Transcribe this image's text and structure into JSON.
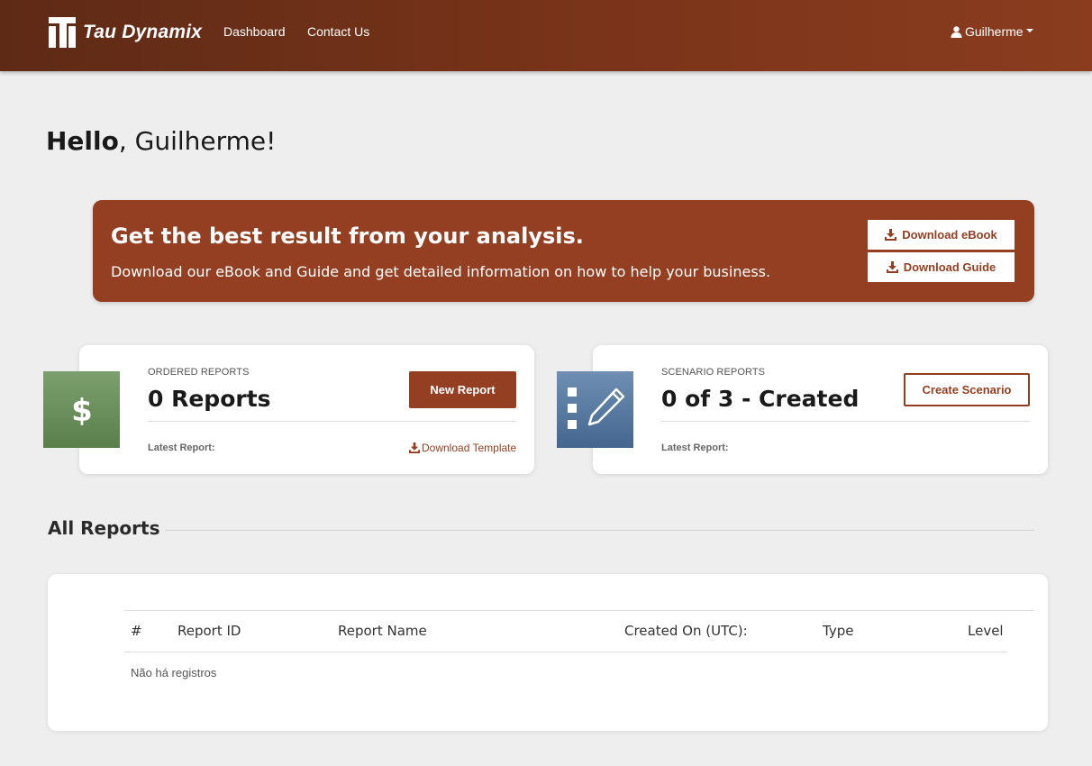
{
  "navbar": {
    "brand": "Tau Dynamix",
    "links": [
      "Dashboard",
      "Contact Us"
    ],
    "user": "Guilherme"
  },
  "greeting": {
    "bold": "Hello",
    "rest": ", Guilherme!"
  },
  "banner": {
    "title": "Get the best result from your analysis.",
    "subtitle": "Download our eBook and Guide and get detailed information on how to help your business.",
    "ebook_label": "Download eBook",
    "guide_label": "Download Guide"
  },
  "ordered_reports": {
    "label": "ORDERED REPORTS",
    "value": "0 Reports",
    "button": "New Report",
    "latest_label": "Latest Report:",
    "template_link": "Download Template",
    "icon": "dollar-icon"
  },
  "scenario_reports": {
    "label": "SCENARIO REPORTS",
    "value": "0 of 3 - Created",
    "button": "Create Scenario",
    "latest_label": "Latest Report:",
    "icon": "list-edit-icon"
  },
  "all_reports": {
    "title": "All Reports",
    "columns": [
      "#",
      "Report ID",
      "Report Name",
      "Created On (UTC):",
      "Type",
      "Level"
    ],
    "empty_message": "Não há registros"
  },
  "colors": {
    "brand": "#953f22",
    "nav_dark": "#5e2a16",
    "green_tile": "#6a8f5c",
    "blue_tile": "#55779f"
  }
}
